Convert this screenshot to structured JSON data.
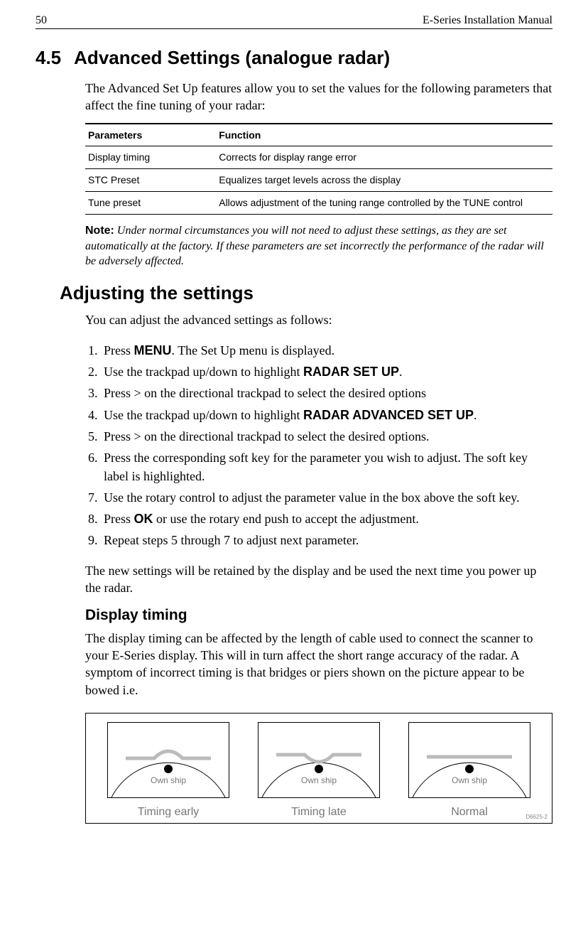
{
  "header": {
    "page_number": "50",
    "doc_title": "E-Series Installation Manual"
  },
  "section": {
    "number": "4.5",
    "title": "Advanced Settings (analogue radar)"
  },
  "intro": "The Advanced Set Up features allow you to set the values for the following parameters that affect the fine tuning of your radar:",
  "table": {
    "head": {
      "c1": "Parameters",
      "c2": "Function"
    },
    "rows": [
      {
        "c1": "Display timing",
        "c2": "Corrects for display range error"
      },
      {
        "c1": "STC Preset",
        "c2": "Equalizes target levels across the display"
      },
      {
        "c1": "Tune preset",
        "c2": "Allows adjustment of the tuning range controlled by the TUNE control"
      }
    ]
  },
  "note": {
    "label": "Note:",
    "text": " Under normal circumstances you will not need to adjust these settings, as they are set automatically at the factory. If these parameters are set incorrectly the performance of the radar will be adversely affected."
  },
  "adjusting": {
    "heading": "Adjusting the settings",
    "intro": "You can adjust the advanced settings as follows:",
    "steps": [
      {
        "pre": "Press ",
        "bold": "MENU",
        "post": ". The Set Up menu is displayed."
      },
      {
        "pre": "Use the trackpad up/down to highlight ",
        "bold": "RADAR SET UP",
        "post": "."
      },
      {
        "pre": "Press > on the directional trackpad to select the desired options",
        "bold": "",
        "post": ""
      },
      {
        "pre": "Use the trackpad up/down to highlight ",
        "bold": "RADAR ADVANCED SET UP",
        "post": "."
      },
      {
        "pre": "Press > on the directional trackpad to select the desired options.",
        "bold": "",
        "post": ""
      },
      {
        "pre": "Press the corresponding soft key for the parameter you wish to adjust. The soft key label is highlighted.",
        "bold": "",
        "post": ""
      },
      {
        "pre": "Use the rotary control to adjust the parameter value in the box above the soft key.",
        "bold": "",
        "post": ""
      },
      {
        "pre": "Press ",
        "bold": "OK",
        "post": " or use the rotary end push to accept the adjustment."
      },
      {
        "pre": "Repeat steps 5 through 7 to adjust next parameter.",
        "bold": "",
        "post": ""
      }
    ],
    "after": "The new settings will be retained by the display and be used the next time you power up the radar."
  },
  "display_timing": {
    "heading": "Display timing",
    "text": "The display timing can be affected by the length of cable used to connect the scanner to your E-Series display. This will in turn affect the short range accuracy of the radar. A symptom of incorrect timing is that bridges or piers shown on the picture appear to be bowed i.e."
  },
  "diagram": {
    "ownship": "Own ship",
    "captions": [
      "Timing early",
      "Timing late",
      "Normal"
    ],
    "ref": "D6625-2"
  }
}
